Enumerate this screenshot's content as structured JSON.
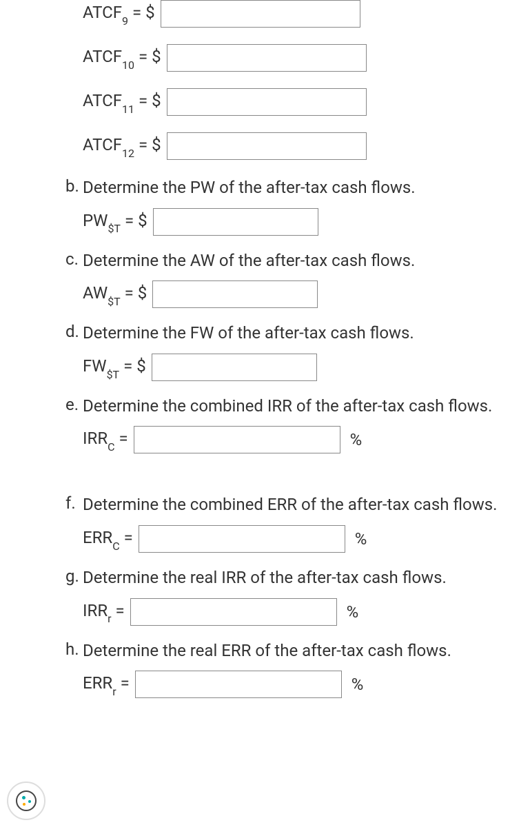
{
  "atcf": {
    "r9": {
      "label": "ATCF",
      "sub": "9",
      "eq": " = $"
    },
    "r10": {
      "label": "ATCF",
      "sub": "10",
      "eq": " = $"
    },
    "r11": {
      "label": "ATCF",
      "sub": "11",
      "eq": " = $"
    },
    "r12": {
      "label": "ATCF",
      "sub": "12",
      "eq": " = $"
    }
  },
  "qb": {
    "marker": "b.",
    "text": "Determine the PW of the after-tax cash flows.",
    "label": "PW",
    "sub": "$T",
    "eq": " = $"
  },
  "qc": {
    "marker": "c.",
    "text": "Determine the AW of the after-tax cash flows.",
    "label": "AW",
    "sub": "$T",
    "eq": " = $"
  },
  "qd": {
    "marker": "d.",
    "text": "Determine the FW of the after-tax cash flows.",
    "label": "FW",
    "sub": "$T",
    "eq": " = $"
  },
  "qe": {
    "marker": "e.",
    "text": "Determine the combined IRR of the after-tax cash flows.",
    "label": "IRR",
    "sub": "C",
    "eq": " = ",
    "unit": "%"
  },
  "qf": {
    "marker": "f.",
    "text": "Determine the combined ERR of the after-tax cash flows.",
    "label": "ERR",
    "sub": "C",
    "eq": " = ",
    "unit": "%"
  },
  "qg": {
    "marker": "g.",
    "text": "Determine the real IRR of the after-tax cash flows.",
    "label": "IRR",
    "sub": "r",
    "eq": " = ",
    "unit": "%"
  },
  "qh": {
    "marker": "h.",
    "text": "Determine the real ERR of the after-tax cash flows.",
    "label": "ERR",
    "sub": "r",
    "eq": " = ",
    "unit": "%"
  }
}
